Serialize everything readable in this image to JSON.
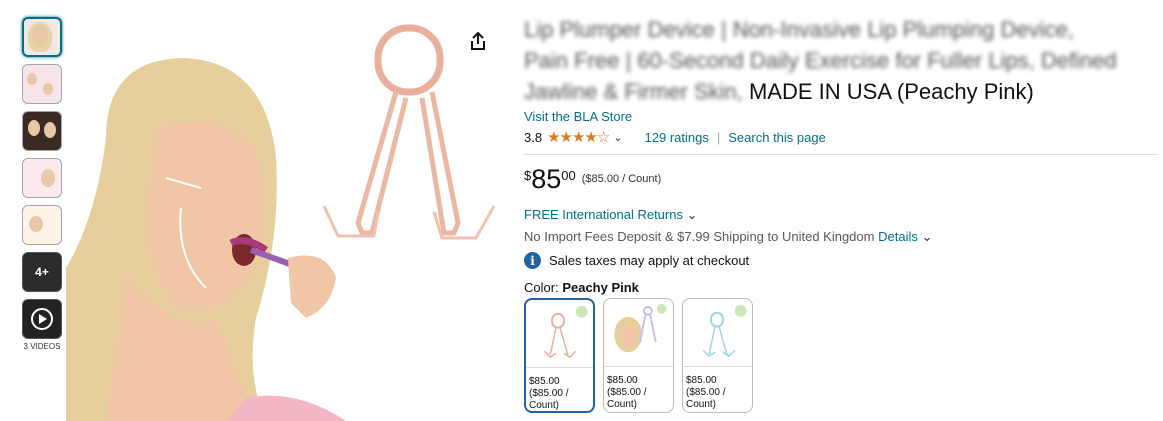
{
  "product": {
    "title_blurred_1": "Lip Plumper Device | Non-Invasive Lip Plumping Device,",
    "title_blurred_2a": "Pain Free | 60-Second Daily Exercise for Fuller Lips, Defined",
    "title_line3a": "Jawline & Firmer Skin,",
    "title_line3b": "MADE IN USA (Peachy Pink)",
    "store_link": "Visit the BLA Store",
    "rating_value": "3.8",
    "rating_stars": "★★★★☆",
    "ratings_count": "129 ratings",
    "search_link": "Search this page",
    "price_currency": "$",
    "price_whole": "85",
    "price_fraction": "00",
    "price_unit": "($85.00 / Count)",
    "returns": "FREE International Returns",
    "shipping": "No Import Fees Deposit & $7.99 Shipping to United Kingdom",
    "details_link": "Details",
    "tax_note": "Sales taxes may apply at checkout",
    "color_label": "Color:",
    "color_selected": "Peachy Pink"
  },
  "thumbs": {
    "more_label": "4+",
    "videos_label": "3 VIDEOS"
  },
  "swatches": [
    {
      "price": "$85.00",
      "unit1": "($85.00 /",
      "unit2": "Count)"
    },
    {
      "price": "$85.00",
      "unit1": "($85.00 /",
      "unit2": "Count)"
    },
    {
      "price": "$85.00",
      "unit1": "($85.00 /",
      "unit2": "Count)"
    }
  ],
  "colors": {
    "link": "#007185",
    "star": "#de7921",
    "selected": "#2162a1",
    "device_pink": "#e8a48e"
  },
  "icons": [
    "share-icon",
    "chevron-down-icon",
    "info-icon",
    "play-icon"
  ]
}
